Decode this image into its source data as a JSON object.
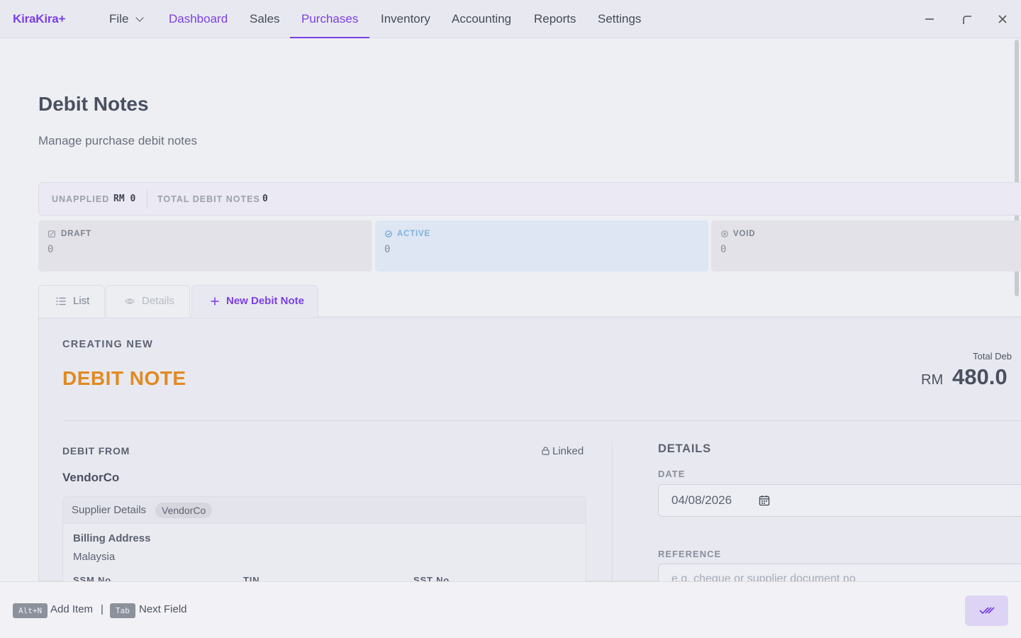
{
  "app": {
    "logo": "KiraKira+"
  },
  "menu": {
    "file": "File",
    "dashboard": "Dashboard",
    "sales": "Sales",
    "purchases": "Purchases",
    "inventory": "Inventory",
    "accounting": "Accounting",
    "reports": "Reports",
    "settings": "Settings",
    "active": "Purchases"
  },
  "page": {
    "title": "Debit Notes",
    "subtitle": "Manage purchase debit notes"
  },
  "summary": {
    "unapplied_label": "UNAPPLIED",
    "unapplied_value": "RM 0",
    "total_label": "TOTAL DEBIT NOTES",
    "total_value": "0"
  },
  "stats": {
    "draft": {
      "label": "DRAFT",
      "value": "0",
      "icon": "edit-icon"
    },
    "active": {
      "label": "ACTIVE",
      "value": "0",
      "icon": "check-circle-icon"
    },
    "void": {
      "label": "VOID",
      "value": "0",
      "icon": "x-circle-icon"
    }
  },
  "tabs": {
    "list": "List",
    "details": "Details",
    "new": "New Debit Note",
    "selected": "New Debit Note"
  },
  "form": {
    "creating": "CREATING NEW",
    "doc_type": "DEBIT NOTE",
    "total_label": "Total Deb",
    "currency": "RM",
    "total_amount": "480.0",
    "debit_from_label": "DEBIT FROM",
    "linked": "Linked",
    "vendor": "VendorCo",
    "supplier_details": "Supplier Details",
    "supplier_chip": "VendorCo",
    "billing_address_label": "Billing Address",
    "billing_address": "Malaysia",
    "ssm_label": "SSM No",
    "tin_label": "TIN",
    "sst_label": "SST No",
    "details_label": "DETAILS",
    "date_label": "DATE",
    "date_value": "04/08/2026",
    "reference_label": "REFERENCE",
    "reference_placeholder": "e.g. cheque or supplier document no"
  },
  "footer": {
    "add_key": "Alt+N",
    "add_text": "Add Item",
    "separator": "|",
    "next_key": "Tab",
    "next_text": "Next Field"
  },
  "colors": {
    "accent": "#7b3fe4",
    "doc_title": "#e08a22",
    "active_stat": "#5b9bd5"
  }
}
